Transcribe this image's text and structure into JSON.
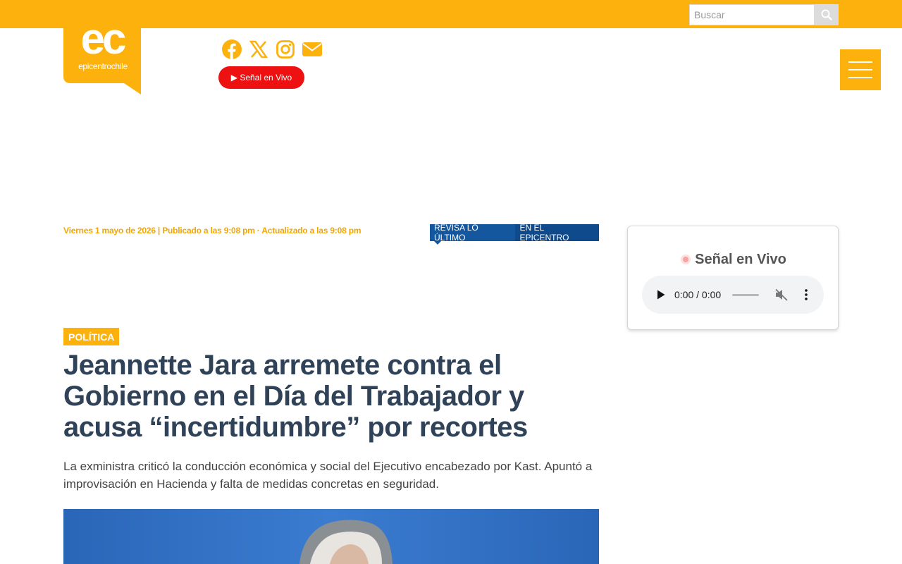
{
  "site": {
    "logo_text": "ec",
    "logo_subtitle": "epicentrochile"
  },
  "header": {
    "search_placeholder": "Buscar",
    "live_button": "▶ Señal en Vivo",
    "social_icons": [
      "facebook-icon",
      "x-icon",
      "instagram-icon",
      "envelope-icon"
    ]
  },
  "article": {
    "dateline": "Viernes 1 mayo de 2026 | Publicado a las 9:08 pm · Actualizado a las 9:08 pm",
    "category": "POLÍTICA",
    "headline": "Jeannette Jara arremete contra el Gobierno en el Día del Trabajador y acusa “incertidumbre” por recortes",
    "lead": "La exministra criticó la conducción económica y social del Ejecutivo encabezado por Kast. Apuntó a improvisación en Hacienda y falta de medidas concretas en seguridad."
  },
  "latest_bar": {
    "label": "REVISA LO ÚLTIMO",
    "title": "EN EL EPICENTRO"
  },
  "sidebar": {
    "live_title": "Señal en Vivo",
    "player_time": "0:00 / 0:00"
  },
  "colors": {
    "brand": "#fdb10c",
    "live_red": "#ee1111",
    "headline": "#2f4257",
    "latest_blue": "#0e4a8c"
  }
}
